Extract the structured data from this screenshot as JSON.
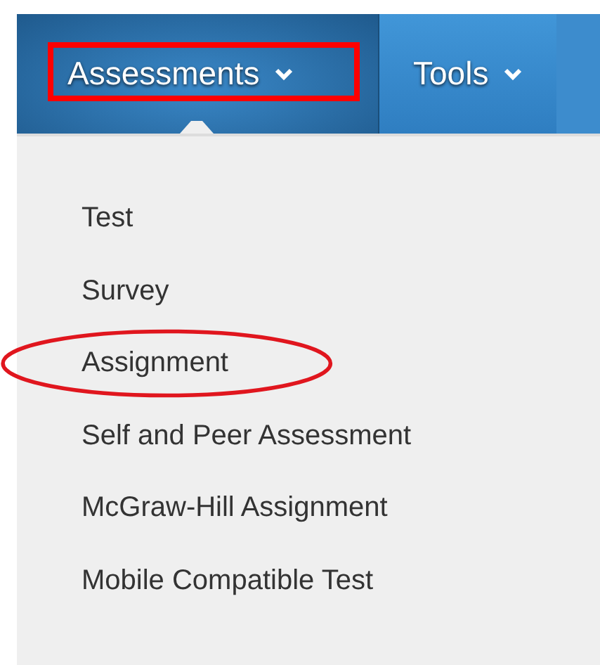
{
  "tabs": [
    {
      "label": "Assessments",
      "selected": true,
      "highlighted": true
    },
    {
      "label": "Tools",
      "selected": false,
      "highlighted": false
    }
  ],
  "menu": {
    "items": [
      {
        "label": "Test",
        "circled": false
      },
      {
        "label": "Survey",
        "circled": false
      },
      {
        "label": "Assignment",
        "circled": true
      },
      {
        "label": "Self and Peer Assessment",
        "circled": false
      },
      {
        "label": "McGraw-Hill Assignment",
        "circled": false
      },
      {
        "label": "Mobile Compatible Test",
        "circled": false
      }
    ]
  }
}
